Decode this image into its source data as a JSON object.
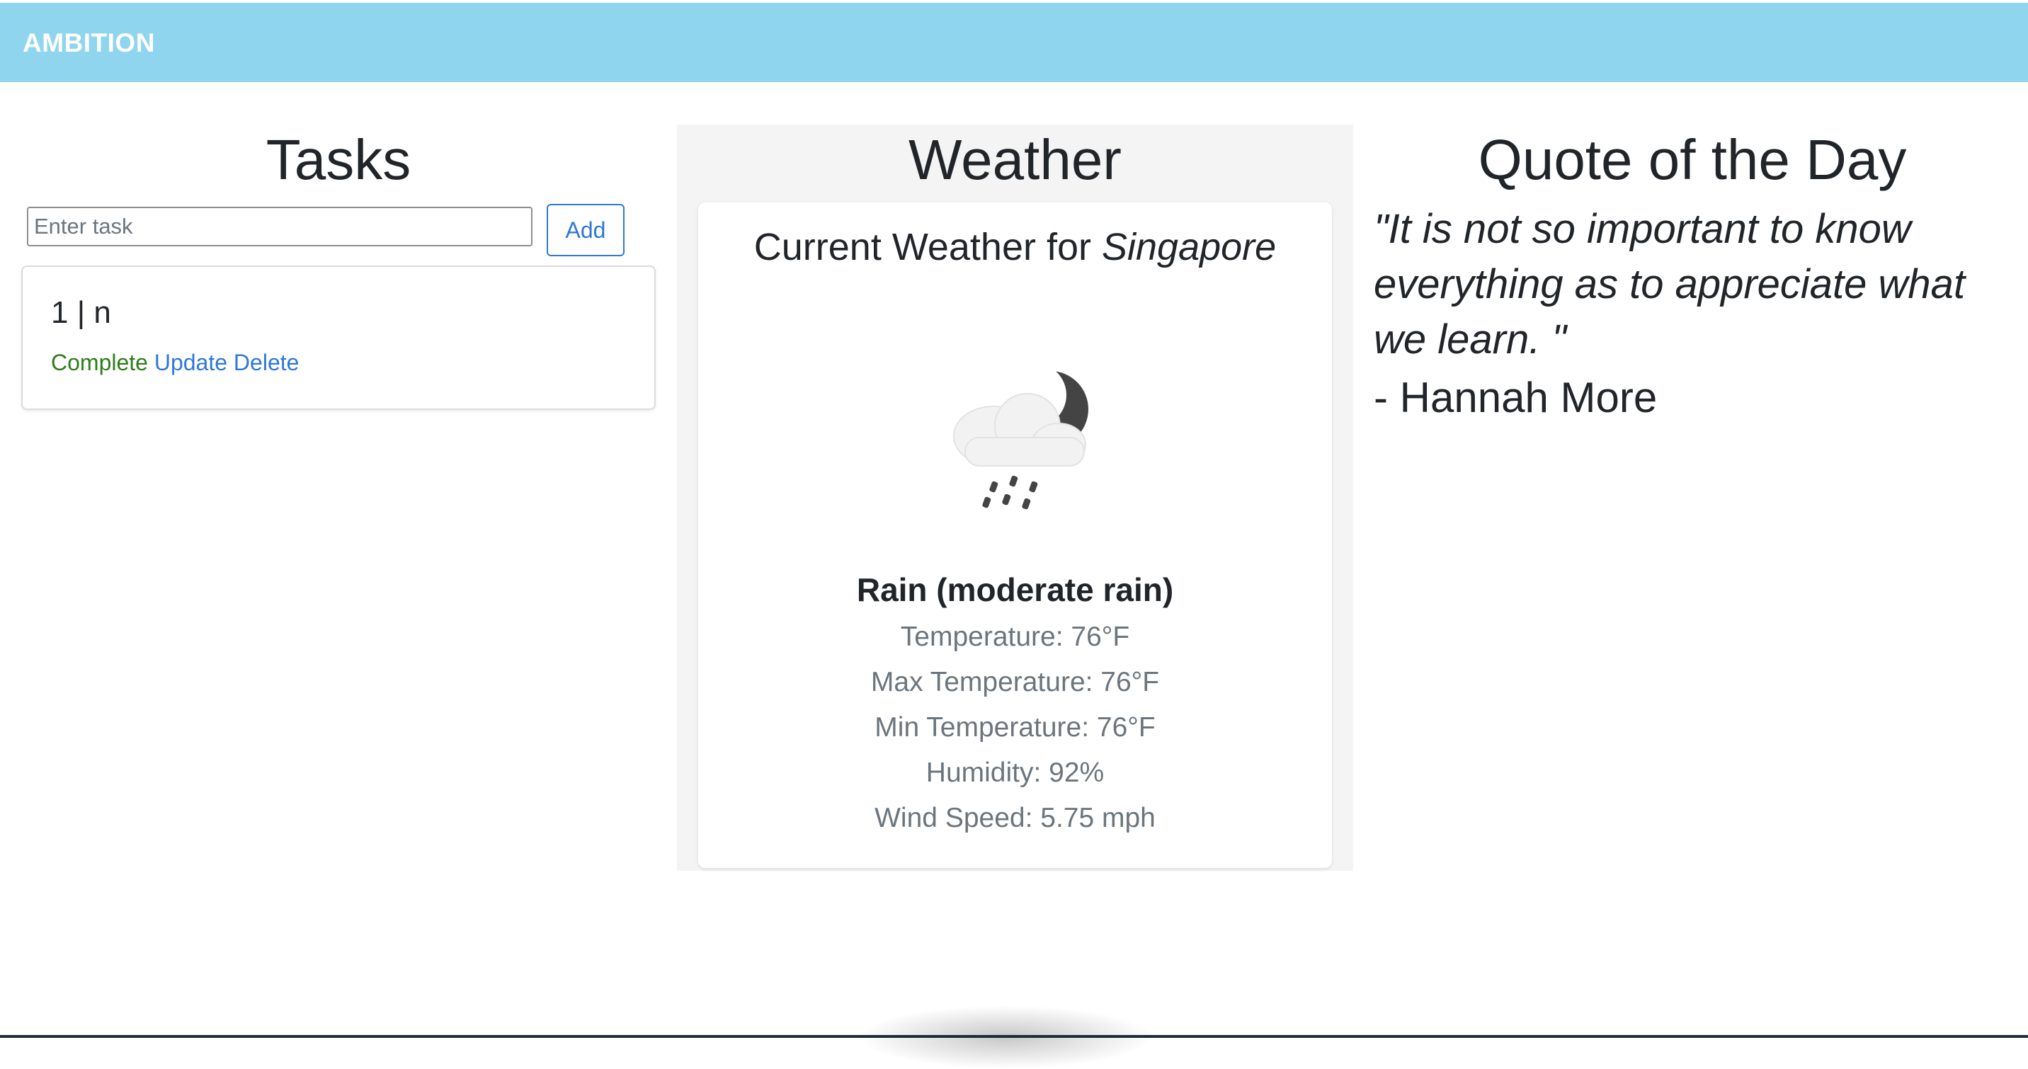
{
  "navbar": {
    "brand": "AMBITION"
  },
  "tasks": {
    "title": "Tasks",
    "input_placeholder": "Enter task",
    "input_value": "",
    "add_label": "Add",
    "items": [
      {
        "title": "1 | n",
        "complete_label": "Complete",
        "update_label": "Update",
        "delete_label": "Delete"
      }
    ]
  },
  "weather": {
    "title": "Weather",
    "heading_prefix": "Current Weather for",
    "city": "Singapore",
    "icon": "night-cloud-rain-icon",
    "description": "Rain (moderate rain)",
    "temperature": "Temperature: 76°F",
    "max_temperature": "Max Temperature: 76°F",
    "min_temperature": "Min Temperature: 76°F",
    "humidity": "Humidity: 92%",
    "wind_speed": "Wind Speed: 5.75 mph"
  },
  "quote": {
    "title": "Quote of the Day",
    "text": "\"It is not so important to know everything as to appreciate what we learn. \"",
    "author": "- Hannah More"
  },
  "colors": {
    "navbar": "#8fd5ee",
    "link": "#2f77d9",
    "complete": "#2e7d1a",
    "panel": "#f4f4f4"
  }
}
